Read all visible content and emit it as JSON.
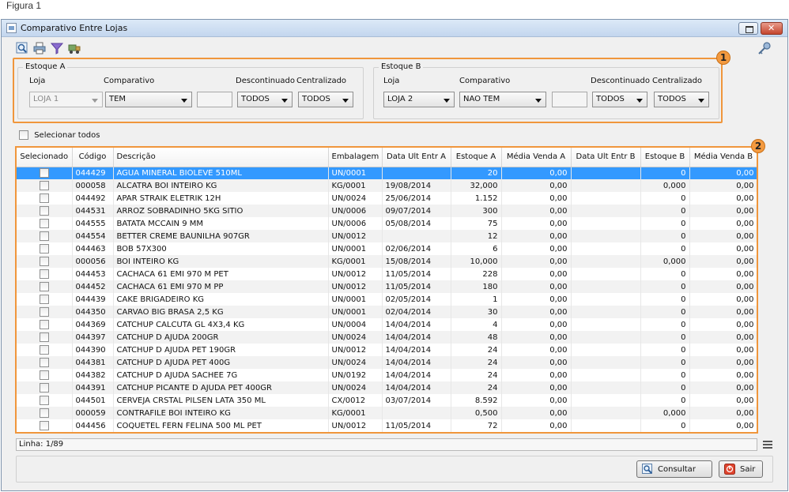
{
  "figure_caption": "Figura 1",
  "window": {
    "title": "Comparativo Entre Lojas"
  },
  "toolbar": {
    "icons": [
      "search-icon",
      "print-icon",
      "filter-icon",
      "truck-icon"
    ],
    "help_icon": "key-icon"
  },
  "badges": {
    "filters": "1",
    "grid": "2"
  },
  "estoque_a": {
    "title": "Estoque A",
    "loja_label": "Loja",
    "loja_value": "LOJA 1",
    "comparativo_label": "Comparativo",
    "comparativo_value": "TEM",
    "descontinuado_label": "Descontinuado",
    "descontinuado_value": "TODOS",
    "centralizado_label": "Centralizado",
    "centralizado_value": "TODOS"
  },
  "estoque_b": {
    "title": "Estoque B",
    "loja_label": "Loja",
    "loja_value": "LOJA 2",
    "comparativo_label": "Comparativo",
    "comparativo_value": "NAO TEM",
    "descontinuado_label": "Descontinuado",
    "descontinuado_value": "TODOS",
    "centralizado_label": "Centralizado",
    "centralizado_value": "TODOS"
  },
  "select_all_label": "Selecionar todos",
  "grid": {
    "headers": [
      "Selecionado",
      "Código",
      "Descrição",
      "Embalagem",
      "Data Ult Entr A",
      "Estoque A",
      "Média Venda A",
      "Data Ult Entr B",
      "Estoque B",
      "Média Venda B"
    ],
    "rows": [
      [
        "044429",
        "AGUA MINERAL BIOLEVE 510ML",
        "UN/0001",
        "",
        "20",
        "0,00",
        "",
        "0",
        "0,00"
      ],
      [
        "000058",
        "ALCATRA BOI INTEIRO KG",
        "KG/0001",
        "19/08/2014",
        "32,000",
        "0,00",
        "",
        "0,000",
        "0,00"
      ],
      [
        "044492",
        "APAR STRAIK ELETRIK 12H",
        "UN/0024",
        "25/06/2014",
        "1.152",
        "0,00",
        "",
        "0",
        "0,00"
      ],
      [
        "044531",
        "ARROZ SOBRADINHO 5KG SITIO",
        "UN/0006",
        "09/07/2014",
        "300",
        "0,00",
        "",
        "0",
        "0,00"
      ],
      [
        "044555",
        "BATATA MCCAIN 9 MM",
        "UN/0006",
        "05/08/2014",
        "75",
        "0,00",
        "",
        "0",
        "0,00"
      ],
      [
        "044554",
        "BETTER CREME BAUNILHA 907GR",
        "UN/0012",
        "",
        "12",
        "0,00",
        "",
        "0",
        "0,00"
      ],
      [
        "044463",
        "BOB 57X300",
        "UN/0001",
        "02/06/2014",
        "6",
        "0,00",
        "",
        "0",
        "0,00"
      ],
      [
        "000056",
        "BOI INTEIRO KG",
        "KG/0001",
        "15/08/2014",
        "10,000",
        "0,00",
        "",
        "0,000",
        "0,00"
      ],
      [
        "044453",
        "CACHACA  61 EMI 970 M PET",
        "UN/0012",
        "11/05/2014",
        "228",
        "0,00",
        "",
        "0",
        "0,00"
      ],
      [
        "044452",
        "CACHACA  61 EMI 970 M PP",
        "UN/0012",
        "11/05/2014",
        "180",
        "0,00",
        "",
        "0",
        "0,00"
      ],
      [
        "044439",
        "CAKE BRIGADEIRO  KG",
        "UN/0001",
        "02/05/2014",
        "1",
        "0,00",
        "",
        "0",
        "0,00"
      ],
      [
        "044350",
        "CARVAO BIG BRASA 2,5 KG",
        "UN/0001",
        "02/04/2014",
        "30",
        "0,00",
        "",
        "0",
        "0,00"
      ],
      [
        "044369",
        "CATCHUP CALCUTA GL 4X3,4 KG",
        "UN/0004",
        "14/04/2014",
        "4",
        "0,00",
        "",
        "0",
        "0,00"
      ],
      [
        "044397",
        "CATCHUP D AJUDA  200GR",
        "UN/0024",
        "14/04/2014",
        "48",
        "0,00",
        "",
        "0",
        "0,00"
      ],
      [
        "044390",
        "CATCHUP D AJUDA PET  190GR",
        "UN/0012",
        "14/04/2014",
        "24",
        "0,00",
        "",
        "0",
        "0,00"
      ],
      [
        "044381",
        "CATCHUP D AJUDA PET 400G",
        "UN/0024",
        "14/04/2014",
        "24",
        "0,00",
        "",
        "0",
        "0,00"
      ],
      [
        "044382",
        "CATCHUP D AJUDA SACHEE  7G",
        "UN/0192",
        "14/04/2014",
        "24",
        "0,00",
        "",
        "0",
        "0,00"
      ],
      [
        "044391",
        "CATCHUP PICANTE  D AJUDA  PET  400GR",
        "UN/0024",
        "14/04/2014",
        "24",
        "0,00",
        "",
        "0",
        "0,00"
      ],
      [
        "044501",
        "CERVEJA CRSTAL PILSEN LATA 350 ML",
        "CX/0012",
        "03/07/2014",
        "8.592",
        "0,00",
        "",
        "0",
        "0,00"
      ],
      [
        "000059",
        "CONTRAFILE BOI INTEIRO KG",
        "KG/0001",
        "",
        "0,500",
        "0,00",
        "",
        "0,000",
        "0,00"
      ],
      [
        "044456",
        "COQUETEL FERN FELINA  500 ML  PET",
        "UN/0012",
        "11/05/2014",
        "72",
        "0,00",
        "",
        "0",
        "0,00"
      ]
    ]
  },
  "status": {
    "linha": "Linha: 1/89"
  },
  "buttons": {
    "consultar": "Consultar",
    "sair": "Sair"
  }
}
